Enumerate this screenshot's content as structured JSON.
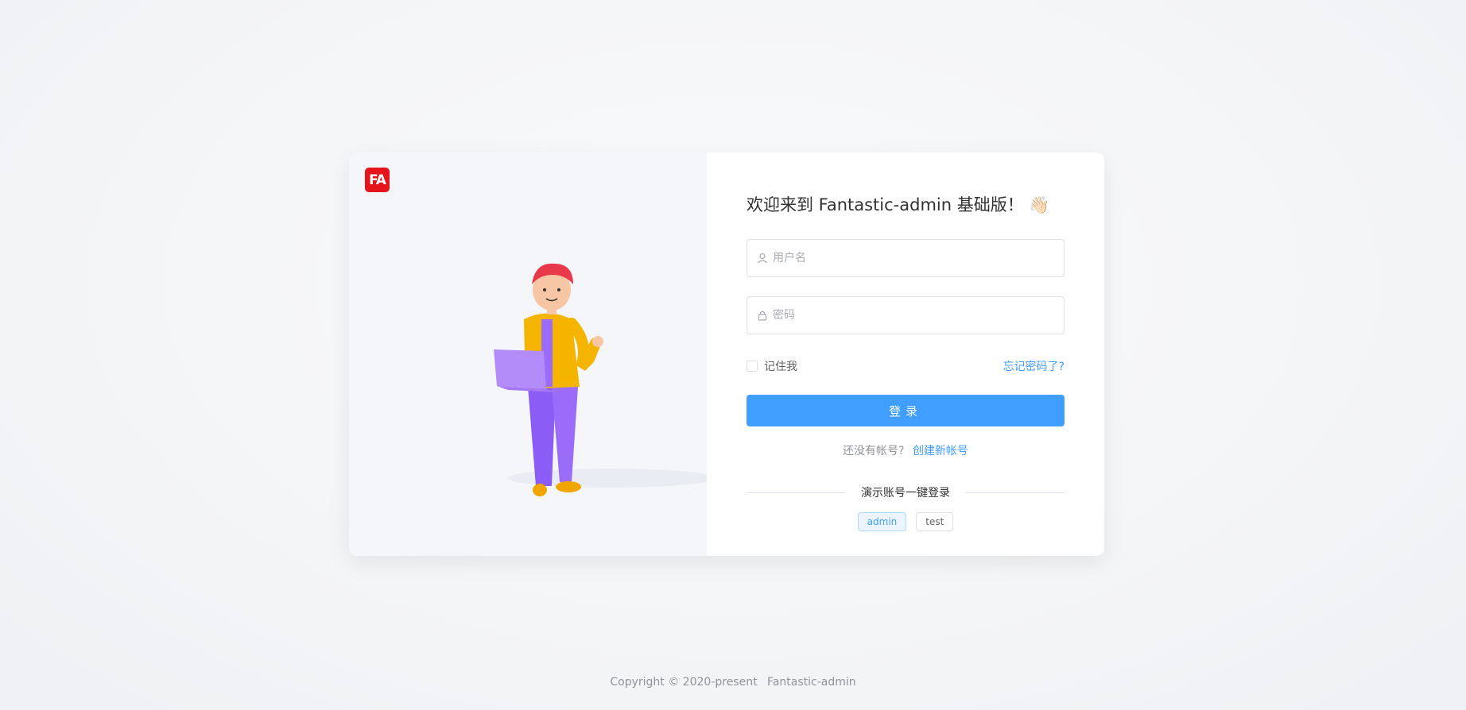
{
  "brand": {
    "logo_text": "FA",
    "logo_color": "#e4161c"
  },
  "login": {
    "title": "欢迎来到 Fantastic-admin 基础版！",
    "title_emoji": "👋🏻",
    "username_placeholder": "用户名",
    "password_placeholder": "密码",
    "remember_label": "记住我",
    "forgot_label": "忘记密码了?",
    "submit_label": "登录",
    "no_account_text": "还没有帐号?",
    "register_label": "创建新帐号",
    "demo_divider_label": "演示账号一键登录",
    "demo_accounts": [
      "admin",
      "test"
    ]
  },
  "footer": {
    "copyright": "Copyright © 2020-present",
    "brand": "Fantastic-admin"
  },
  "colors": {
    "primary": "#409eff",
    "banner_bg": "#f4f6fa"
  },
  "icons": {
    "username": "user-icon",
    "password": "lock-icon"
  }
}
